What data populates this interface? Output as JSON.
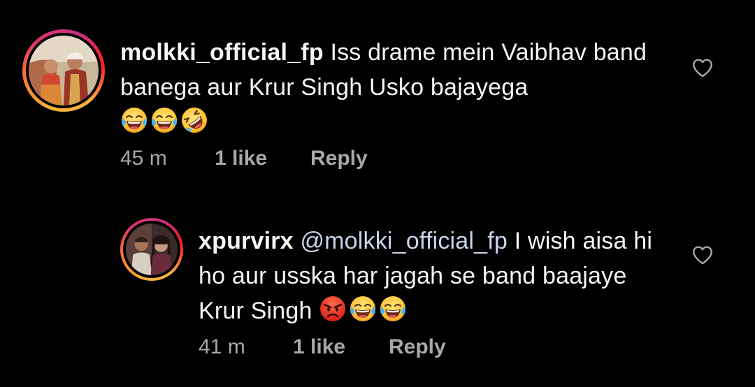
{
  "comments": [
    {
      "username": "molkki_official_fp",
      "text": "Iss drame mein Vaibhav band banega aur Krur Singh Usko bajayega",
      "emojis": [
        "face-with-tears-of-joy",
        "face-with-tears-of-joy",
        "rolling-on-the-floor-laughing"
      ],
      "time": "45 m",
      "likes": "1 like",
      "reply_label": "Reply"
    },
    {
      "username": "xpurvirx",
      "mention": "@molkki_official_fp",
      "text": "I wish aisa hi ho aur usska har jagah se band baajaye Krur Singh",
      "emojis": [
        "angry-face",
        "face-with-tears-of-joy",
        "face-with-tears-of-joy"
      ],
      "time": "41 m",
      "likes": "1 like",
      "reply_label": "Reply"
    }
  ],
  "colors": {
    "background": "#000000",
    "text": "#f5f5f5",
    "meta": "#a8a8a8",
    "mention": "#c9d3e8"
  }
}
